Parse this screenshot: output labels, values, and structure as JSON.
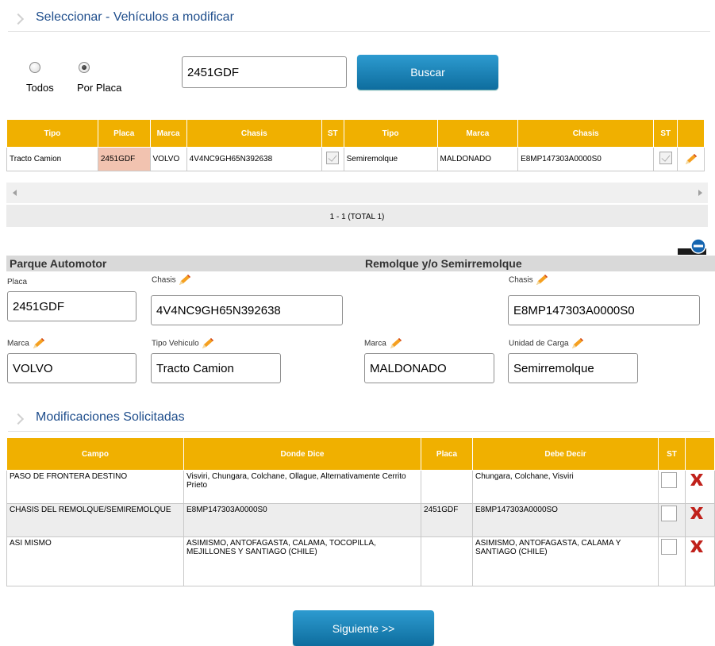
{
  "header": {
    "title": "Seleccionar - Vehículos a modificar"
  },
  "search": {
    "radio_all_label": "Todos",
    "radio_plate_label": "Por Placa",
    "value": "2451GDF",
    "button_label": "Buscar"
  },
  "results": {
    "headers": [
      "Tipo",
      "Placa",
      "Marca",
      "Chasis",
      "ST",
      "Tipo",
      "Marca",
      "Chasis",
      "ST"
    ],
    "row": {
      "tipo": "Tracto Camion",
      "placa": "2451GDF",
      "marca": "VOLVO",
      "chasis": "4V4NC9GH65N392638",
      "tipo2": "Semiremolque",
      "marca2": "MALDONADO",
      "chasis2": "E8MP147303A0000S0"
    },
    "pager": "1 - 1 (TOTAL 1)"
  },
  "parque": {
    "title": "Parque Automotor",
    "placa_label": "Placa",
    "placa": "2451GDF",
    "chasis_label": "Chasis",
    "chasis": "4V4NC9GH65N392638",
    "marca_label": "Marca",
    "marca": "VOLVO",
    "tipo_label": "Tipo Vehiculo",
    "tipo": "Tracto Camion"
  },
  "remolque": {
    "title": "Remolque y/o Semirremolque",
    "chasis_label": "Chasis",
    "chasis": "E8MP147303A0000S0",
    "marca_label": "Marca",
    "marca": "MALDONADO",
    "unidad_label": "Unidad de Carga",
    "unidad": "Semirremolque"
  },
  "modificaciones": {
    "title": "Modificaciones Solicitadas",
    "headers": [
      "Campo",
      "Donde Dice",
      "Placa",
      "Debe Decir",
      "ST"
    ],
    "rows": [
      {
        "campo": "PASO DE FRONTERA DESTINO",
        "dice": "Visviri, Chungara, Colchane, Ollague, Alternativamente Cerrito Prieto",
        "placa": "",
        "debe": "Chungara, Colchane, Visviri"
      },
      {
        "campo": "CHASIS DEL REMOLQUE/SEMIREMOLQUE",
        "dice": "E8MP147303A0000S0",
        "placa": "2451GDF",
        "debe": "E8MP147303A0000SO"
      },
      {
        "campo": "ASI MISMO",
        "dice": "ASIMISMO, ANTOFAGASTA, CALAMA, TOCOPILLA, MEJILLONES Y SANTIAGO (CHILE)",
        "placa": "",
        "debe": "ASIMISMO, ANTOFAGASTA, CALAMA Y SANTIAGO (CHILE)"
      }
    ]
  },
  "next_button": "Siguiente >>",
  "colors": {
    "header_orange": "#f0b000",
    "title_blue": "#1f4e8c",
    "button_blue": "#1a82b8",
    "placa_highlight": "#f2c3b0"
  }
}
